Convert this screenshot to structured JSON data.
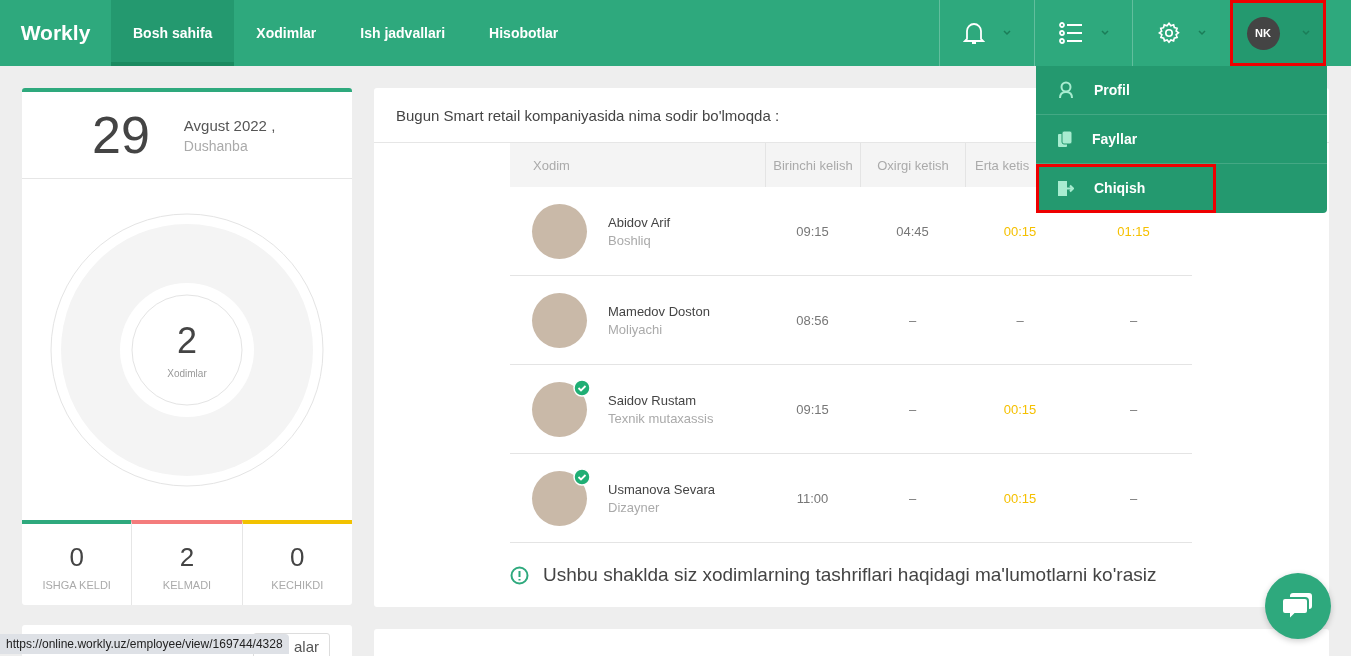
{
  "header": {
    "logo": "Workly",
    "nav": [
      {
        "label": "Bosh sahifa",
        "selected": true
      },
      {
        "label": "Xodimlar",
        "selected": false
      },
      {
        "label": "Ish jadvallari",
        "selected": false
      },
      {
        "label": "Hisobotlar",
        "selected": false
      }
    ],
    "tools": [
      {
        "kind": "bell"
      },
      {
        "kind": "list"
      },
      {
        "kind": "gear"
      }
    ],
    "avatar": {
      "initials": "NK",
      "highlighted": true
    }
  },
  "user_menu": [
    {
      "kind": "profile",
      "label": "Profil",
      "highlighted": false
    },
    {
      "kind": "files",
      "label": "Fayllar",
      "highlighted": false
    },
    {
      "kind": "exit",
      "label": "Chiqish",
      "highlighted": true
    }
  ],
  "date_card": {
    "day": "29",
    "month_year": "Avgust 2022 ,",
    "weekday": "Dushanba",
    "total": "2",
    "total_label": "Xodimlar",
    "stats": [
      {
        "value": "0",
        "label": "ISHGA KELDI",
        "color": "#2ea97d"
      },
      {
        "value": "2",
        "label": "KELMADI",
        "color": "#f47c7c"
      },
      {
        "value": "0",
        "label": "KECHIKDI",
        "color": "#f2c200"
      }
    ]
  },
  "second_card": {
    "button_text": "alar"
  },
  "status_url": "https://online.workly.uz/employee/view/169744/4328",
  "activity": {
    "title": "Bugun Smart retail kompaniyasida nima sodir bo'lmoqda :",
    "columns": [
      "Xodim",
      "Birinchi kelish",
      "Oxirgi ketish",
      "Erta ketis"
    ],
    "rows": [
      {
        "cells": [
          {
            "kind": "person",
            "name": "Abidov Arif",
            "role": "Boshliq",
            "verified": false
          },
          {
            "kind": "time",
            "text": "09:15",
            "warn": false
          },
          {
            "kind": "time",
            "text": "04:45",
            "warn": false
          },
          {
            "kind": "time",
            "text": "00:15",
            "warn": true
          },
          {
            "kind": "time",
            "text": "01:15",
            "warn": true
          }
        ]
      },
      {
        "cells": [
          {
            "kind": "person",
            "name": "Mamedov Doston",
            "role": "Moliyachi",
            "verified": false
          },
          {
            "kind": "time",
            "text": "08:56",
            "warn": false
          },
          {
            "kind": "time",
            "text": "–",
            "warn": false
          },
          {
            "kind": "time",
            "text": "–",
            "warn": false
          },
          {
            "kind": "time",
            "text": "–",
            "warn": false
          }
        ]
      },
      {
        "cells": [
          {
            "kind": "person",
            "name": "Saidov Rustam",
            "role": "Texnik mutaxassis",
            "verified": true
          },
          {
            "kind": "time",
            "text": "09:15",
            "warn": false
          },
          {
            "kind": "time",
            "text": "–",
            "warn": false
          },
          {
            "kind": "time",
            "text": "00:15",
            "warn": true
          },
          {
            "kind": "time",
            "text": "–",
            "warn": false
          }
        ]
      },
      {
        "cells": [
          {
            "kind": "person",
            "name": "Usmanova Sevara",
            "role": "Dizayner",
            "verified": true
          },
          {
            "kind": "time",
            "text": "11:00",
            "warn": false
          },
          {
            "kind": "time",
            "text": "–",
            "warn": false
          },
          {
            "kind": "time",
            "text": "00:15",
            "warn": true
          },
          {
            "kind": "time",
            "text": "–",
            "warn": false
          }
        ]
      }
    ],
    "notice": "Ushbu shaklda siz xodimlarning tashriflari haqidagi ma'lumotlarni ko'rasiz"
  }
}
